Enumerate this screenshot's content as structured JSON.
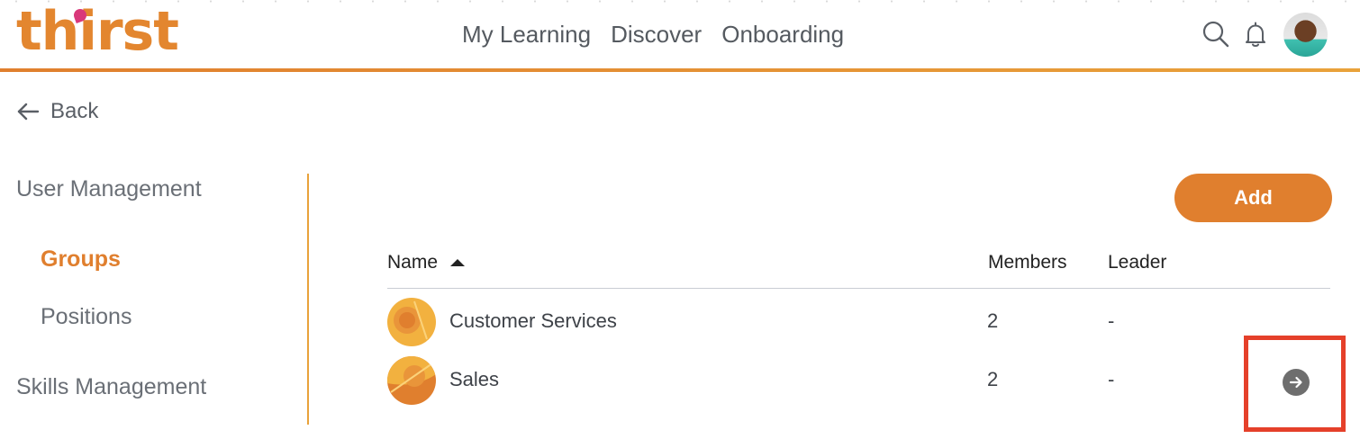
{
  "header": {
    "logo": "thirst",
    "nav": [
      "My Learning",
      "Discover",
      "Onboarding"
    ],
    "icons": [
      "search-icon",
      "bell-icon"
    ],
    "accent": "#e07f2e"
  },
  "back": {
    "label": "Back",
    "icon": "arrow-left-icon"
  },
  "sidebar": {
    "sections": [
      {
        "label": "User Management",
        "items": [
          {
            "label": "Groups",
            "active": true
          },
          {
            "label": "Positions",
            "active": false
          }
        ]
      },
      {
        "label": "Skills Management",
        "items": []
      }
    ]
  },
  "main": {
    "add_label": "Add",
    "columns": {
      "name": "Name",
      "members": "Members",
      "leader": "Leader"
    },
    "sort": {
      "column": "Name",
      "direction": "ascending"
    },
    "rows": [
      {
        "name": "Customer Services",
        "members": "2",
        "leader": "-"
      },
      {
        "name": "Sales",
        "members": "2",
        "leader": "-"
      }
    ],
    "row_action_icon": "arrow-right-circle-icon",
    "highlight_color": "#e5402a"
  }
}
